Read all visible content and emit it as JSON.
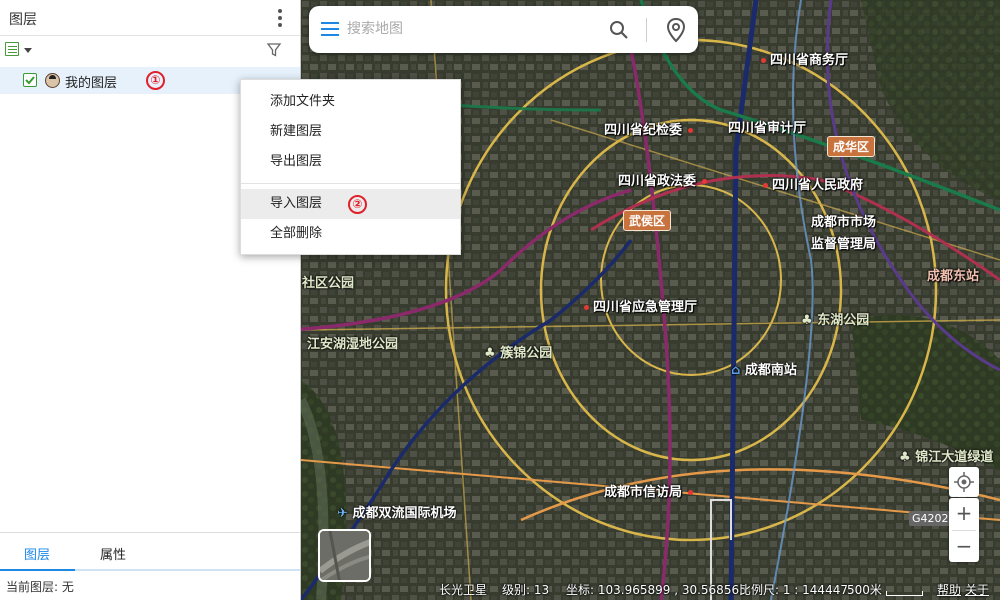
{
  "sidebar": {
    "title": "图层",
    "layer": {
      "label": "我的图层",
      "checked": true,
      "marker": "①"
    },
    "tabs": [
      {
        "label": "图层",
        "active": true
      },
      {
        "label": "属性",
        "active": false
      }
    ],
    "current_layer": "当前图层: 无"
  },
  "search": {
    "placeholder": "搜索地图"
  },
  "context_menu": {
    "items": [
      {
        "label": "添加文件夹"
      },
      {
        "label": "新建图层"
      },
      {
        "label": "导出图层"
      },
      {
        "label": "导入图层",
        "marker": "②",
        "highlighted": true
      },
      {
        "label": "全部删除"
      }
    ]
  },
  "map": {
    "pois": {
      "p1": "四川省商务厅",
      "p2": "四川省纪检委",
      "p3": "四川省审计厅",
      "p4": "四川省政法委",
      "p5": "四川省人民政府",
      "p6": "成都市市场",
      "p6b": "监督管理局",
      "p7": "四川省应急管理厅",
      "p8": "成都市信访局"
    },
    "districts": {
      "d1": "成华区",
      "d2": "武侯区",
      "d3": "成都东站"
    },
    "parks": {
      "k1": "江安湖湿地公园",
      "k2": "簇锦公园",
      "k3": "东湖公园",
      "k4": "锦江大道绿道",
      "k5": "社区公园"
    },
    "stations": {
      "s1": "成都南站",
      "s2": "成都双流国际机场"
    },
    "road_badge": "G4202",
    "controls": {
      "zoom_in": "+",
      "zoom_out": "−"
    },
    "colors": {
      "accent": "#1e88e5",
      "marker": "#e0202a",
      "district": "#c8733e"
    }
  },
  "statusbar": {
    "source": "长光卫星",
    "level": "级别: 13",
    "coords": "坐标: 103.965899 , 30.568565",
    "scale": "比例尺: 1 : 144447",
    "scale_dist": "500米",
    "help": "帮助",
    "about": "关于"
  }
}
